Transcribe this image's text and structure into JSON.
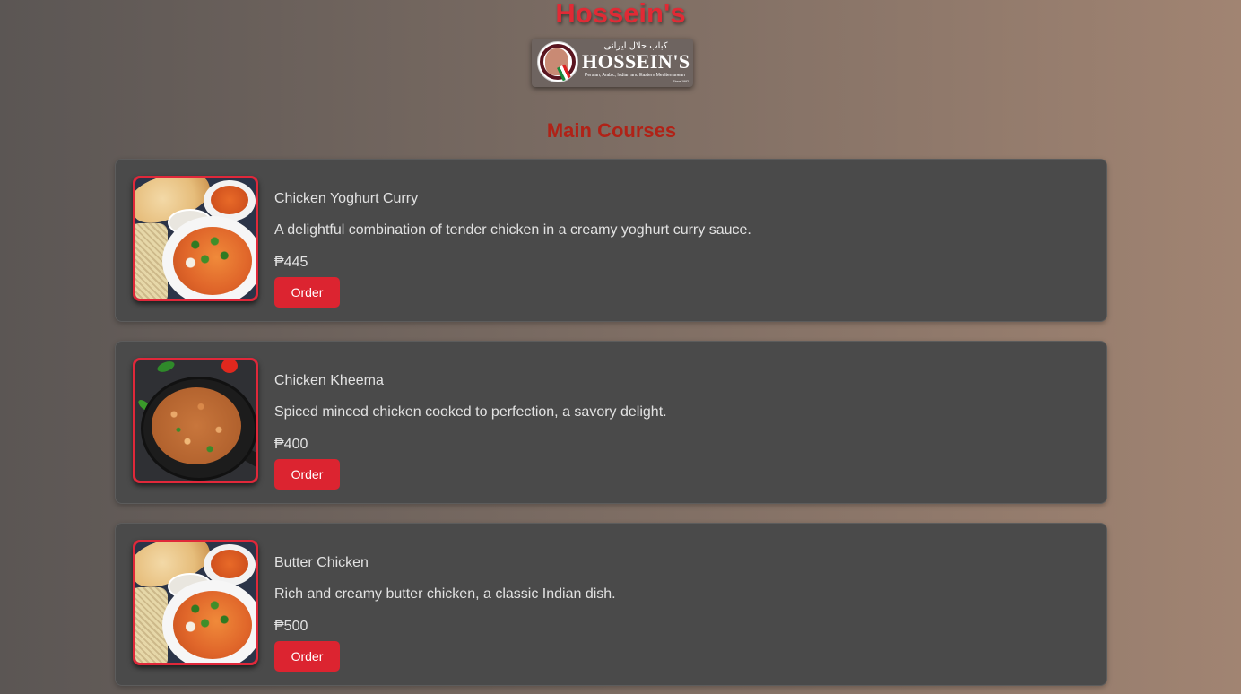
{
  "header": {
    "title": "Hossein's"
  },
  "logo": {
    "arabic_text": "کباب   حلال   ایرانی",
    "brand": "HOSSEIN'S",
    "tagline": "Persian, Arabic, Indian and Eastern Mediterranean",
    "since": "Since 1992"
  },
  "section": {
    "title": "Main Courses"
  },
  "menu": {
    "items": [
      {
        "name": "Chicken Yoghurt Curry",
        "description": "A delightful combination of tender chicken in a creamy yoghurt curry sauce.",
        "price": "₱445",
        "order_label": "Order",
        "image_icon": "curry-bowl-photo"
      },
      {
        "name": "Chicken Kheema",
        "description": "Spiced minced chicken cooked to perfection, a savory delight.",
        "price": "₱400",
        "order_label": "Order",
        "image_icon": "kheema-pan-photo"
      },
      {
        "name": "Butter Chicken",
        "description": "Rich and creamy butter chicken, a classic Indian dish.",
        "price": "₱500",
        "order_label": "Order",
        "image_icon": "curry-bowl-photo"
      }
    ]
  },
  "colors": {
    "accent": "#dc2430",
    "section_title": "#b02217",
    "card_bg": "#4a4a4a",
    "text": "#e2e2e2"
  }
}
